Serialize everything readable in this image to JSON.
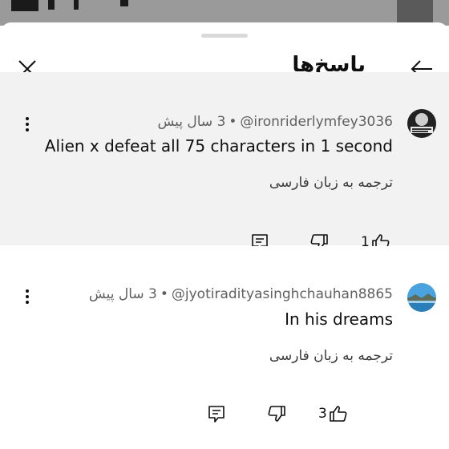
{
  "header": {
    "title": "پاسخ‌ها"
  },
  "icons": {
    "close": "close-icon",
    "back": "arrow-back-icon",
    "more": "more-vert-icon",
    "reply": "comment-reply-icon",
    "dislike": "thumb-down-icon",
    "like": "thumb-up-icon"
  },
  "comments": [
    {
      "author": "@ironriderlymfey3036",
      "separator": "•",
      "time": "3 سال پیش",
      "text": "Alien x defeat all 75 characters in 1 second",
      "translate": "ترجمه به زبان فارسی",
      "likes": "1"
    },
    {
      "author": "@jyotiradityasinghchauhan8865",
      "separator": "•",
      "time": "3 سال پیش",
      "text": "In his dreams",
      "translate": "ترجمه به زبان فارسی",
      "likes": "3"
    }
  ],
  "colors": {
    "highlight_bg": "#f2f2f2",
    "meta_text": "#606060"
  }
}
